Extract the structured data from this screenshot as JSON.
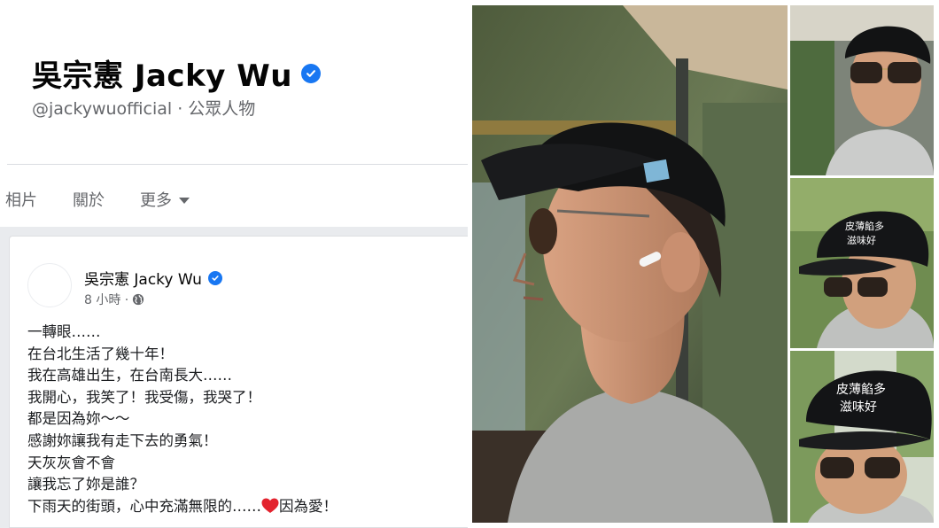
{
  "page": {
    "name": "吳宗憲 Jacky Wu",
    "handle_line": "@jackywuofficial · 公眾人物",
    "verified_color": "#1877f2"
  },
  "tabs": [
    {
      "label": "相片"
    },
    {
      "label": "關於"
    },
    {
      "label": "更多"
    }
  ],
  "post": {
    "author": "吳宗憲 Jacky Wu",
    "time": "8 小時 ·",
    "privacy_icon": "globe-icon",
    "lines": [
      "一轉眼……",
      "在台北生活了幾十年！",
      "我在高雄出生，在台南長大……",
      "我開心，我笑了！我受傷，我哭了！",
      "都是因為妳～～",
      "感謝妳讓我有走下去的勇氣！",
      "天灰灰會不會",
      "讓我忘了妳是誰？"
    ],
    "last_line_before": "下雨天的街頭，心中充滿無限的……",
    "last_line_after": "因為愛！",
    "heart_icon": "red-heart-icon"
  },
  "photos": {
    "cap_text_line1": "皮薄餡多",
    "cap_text_line2": "滋味好"
  }
}
